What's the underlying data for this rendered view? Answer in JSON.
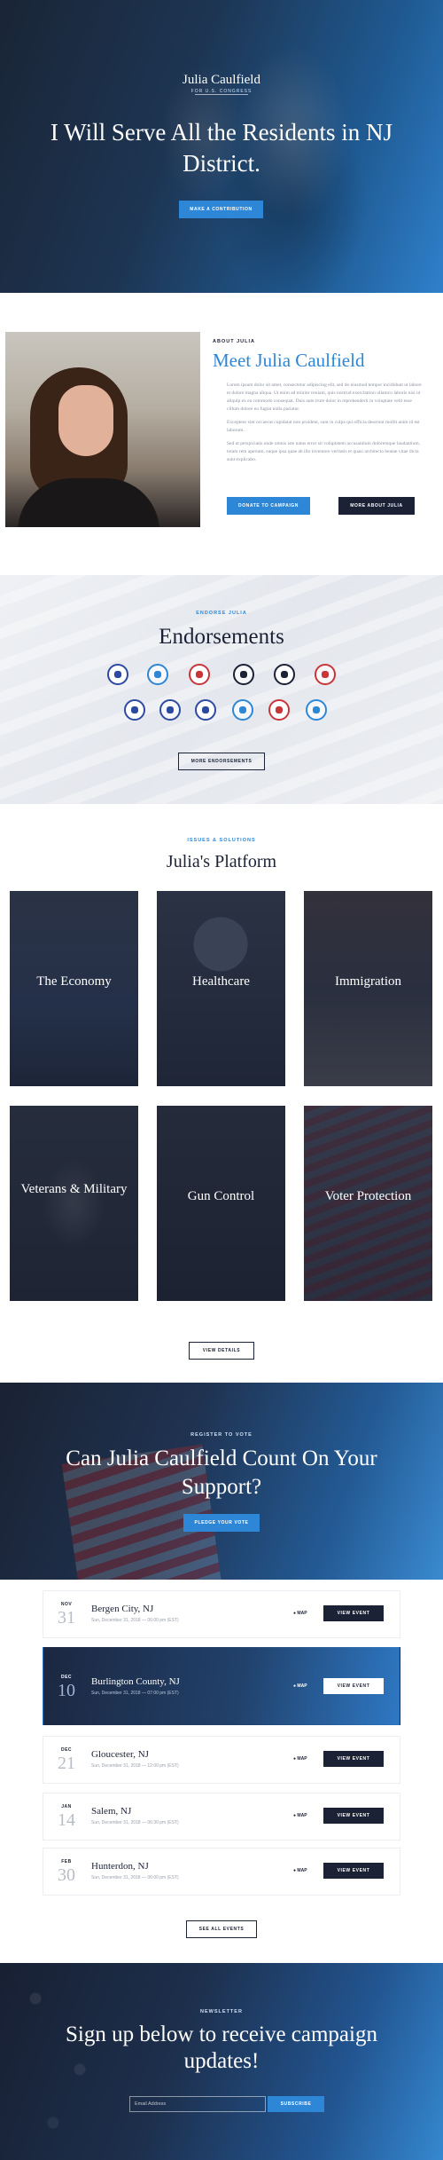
{
  "hero": {
    "site_name": "Julia Caulfield",
    "site_tagline": "FOR U.S. CONGRESS",
    "headline": "I Will Serve All the Residents in NJ District.",
    "cta": "Make a contribution"
  },
  "about": {
    "kicker": "ABOUT JULIA",
    "title": "Meet Julia Caulfield",
    "paragraphs": [
      "Lorem ipsum dolor sit amet, consectetur adipiscing elit, sed do eiusmod tempor incididunt ut labore et dolore magna aliqua. Ut enim ad minim veniam, quis nostrud exercitation ullamco laboris nisi ut aliquip ex ea commodo consequat. Duis aute irure dolor in reprehenderit in voluptate velit esse cillum dolore eu fugiat nulla pariatur.",
      "Excepteur sint occaecat cupidatat non proident, sunt in culpa qui officia deserunt mollit anim id est laborum.",
      "Sed ut perspiciatis unde omnis iste natus error sit voluptatem accusantium doloremque laudantium, totam rem aperiam, eaque ipsa quae ab illo inventore veritatis et quasi architecto beatae vitae dicta sunt explicabo."
    ],
    "donate": "Donate to campaign",
    "more": "More about Julia"
  },
  "endorsements": {
    "kicker": "ENDORSE JULIA",
    "title": "Endorsements",
    "button": "More endorsements",
    "logo_colors": [
      "#2c4aa0",
      "#2e87d6",
      "#c8363a",
      "#1c2236",
      "#1c2236",
      "#c8363a",
      "#2c4aa0",
      "#2c4aa0",
      "#2c4aa0",
      "#2e87d6",
      "#c8363a",
      "#2e87d6"
    ]
  },
  "platform": {
    "kicker": "ISSUES & SOLUTIONS",
    "title": "Julia's Platform",
    "tiles": [
      "The Economy",
      "Healthcare",
      "Immigration",
      "Veterans & Military",
      "Gun Control",
      "Voter Protection"
    ],
    "button": "View details"
  },
  "support": {
    "kicker": "REGISTER TO VOTE",
    "title": "Can Julia Caulfield Count On Your Support?",
    "cta": "Pledge your vote"
  },
  "events": {
    "map_label": "MAP",
    "view_label": "View event",
    "see_all": "See all events",
    "items": [
      {
        "month": "NOV",
        "day": "31",
        "name": "Bergen City, NJ",
        "date": "Sun, December 31, 2018 — 06:00 pm (EST)"
      },
      {
        "month": "DEC",
        "day": "10",
        "name": "Burlington County, NJ",
        "date": "Sun, December 31, 2018 — 07:00 pm (EST)"
      },
      {
        "month": "DEC",
        "day": "21",
        "name": "Gloucester, NJ",
        "date": "Sun, December 31, 2018 — 12:00 pm (EST)"
      },
      {
        "month": "JAN",
        "day": "14",
        "name": "Salem, NJ",
        "date": "Sun, December 31, 2018 — 06:30 pm (EST)"
      },
      {
        "month": "FEB",
        "day": "30",
        "name": "Hunterdon, NJ",
        "date": "Sun, December 31, 2018 — 06:00 pm (EST)"
      }
    ]
  },
  "newsletter": {
    "kicker": "NEWSLETTER",
    "title": "Sign up below to receive campaign updates!",
    "email_placeholder": "Email Address",
    "subscribe": "Subscribe"
  }
}
